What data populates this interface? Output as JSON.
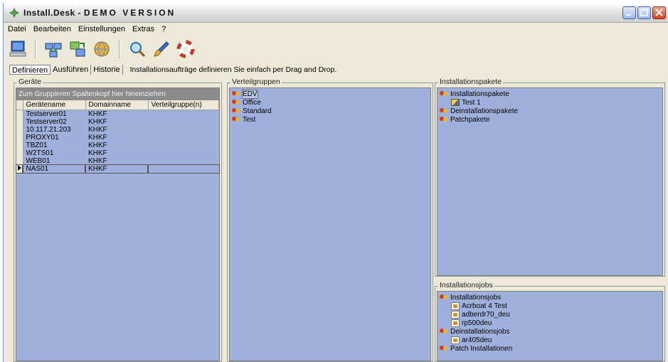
{
  "window": {
    "title_prefix": "Install.Desk - ",
    "title_demo": "DEMO VERSION"
  },
  "menu": [
    {
      "label": "Datei"
    },
    {
      "label": "Bearbeiten"
    },
    {
      "label": "Einstellungen"
    },
    {
      "label": "Extras"
    },
    {
      "label": "?"
    }
  ],
  "toolbar": {
    "buttons": [
      "computer-icon",
      "network-icon",
      "transfer-icon",
      "globe-icon",
      "search-icon",
      "brush-icon",
      "lifebuoy-icon"
    ]
  },
  "tabs": {
    "items": [
      "Definieren",
      "Ausführen",
      "Historie"
    ],
    "active": "Definieren",
    "hint": "Installationsaufträge definieren Sie einfach per Drag and Drop."
  },
  "geraete": {
    "label": "Geräte",
    "group_header": "Zum Gruppieren Spaltenkopf hier hineinziehen",
    "columns": [
      "Gerätename",
      "Domainname",
      "Verteilgruppe(n)"
    ],
    "rows": [
      {
        "name": "Testserver01",
        "domain": "KHKF",
        "group": ""
      },
      {
        "name": "Testserver02",
        "domain": "KHKF",
        "group": ""
      },
      {
        "name": "10.117.21.203",
        "domain": "KHKF",
        "group": ""
      },
      {
        "name": "PROXY01",
        "domain": "KHKF",
        "group": ""
      },
      {
        "name": "TBZ01",
        "domain": "KHKF",
        "group": ""
      },
      {
        "name": "W2TS01",
        "domain": "KHKF",
        "group": ""
      },
      {
        "name": "WEB01",
        "domain": "KHKF",
        "group": ""
      },
      {
        "name": "NAS01",
        "domain": "KHKF",
        "group": ""
      }
    ],
    "selected_index": 7
  },
  "verteilgruppen": {
    "label": "Verteilgruppen",
    "items": [
      "EDV",
      "Office",
      "Standard",
      "Test"
    ],
    "selected": "EDV"
  },
  "installationspakete": {
    "label": "Installationspakete",
    "tree": [
      {
        "text": "Installationspakete",
        "level": 1,
        "icon": "group"
      },
      {
        "text": "Test 1",
        "level": 2,
        "icon": "package"
      },
      {
        "text": "Deinstallationspakete",
        "level": 1,
        "icon": "group"
      },
      {
        "text": "Patchpakete",
        "level": 1,
        "icon": "group"
      }
    ]
  },
  "installationsjobs": {
    "label": "Installationsjobs",
    "tree": [
      {
        "text": "Installationsjobs",
        "level": 1,
        "icon": "group"
      },
      {
        "text": "Acrboat 4 Test",
        "level": 2,
        "icon": "job"
      },
      {
        "text": "adberdr70_deu",
        "level": 2,
        "icon": "job"
      },
      {
        "text": "rp500deu",
        "level": 2,
        "icon": "job"
      },
      {
        "text": "Deinstallationsjobs",
        "level": 1,
        "icon": "group"
      },
      {
        "text": "ar405deu",
        "level": 2,
        "icon": "job"
      },
      {
        "text": "Patch Installationen",
        "level": 1,
        "icon": "group"
      }
    ]
  }
}
